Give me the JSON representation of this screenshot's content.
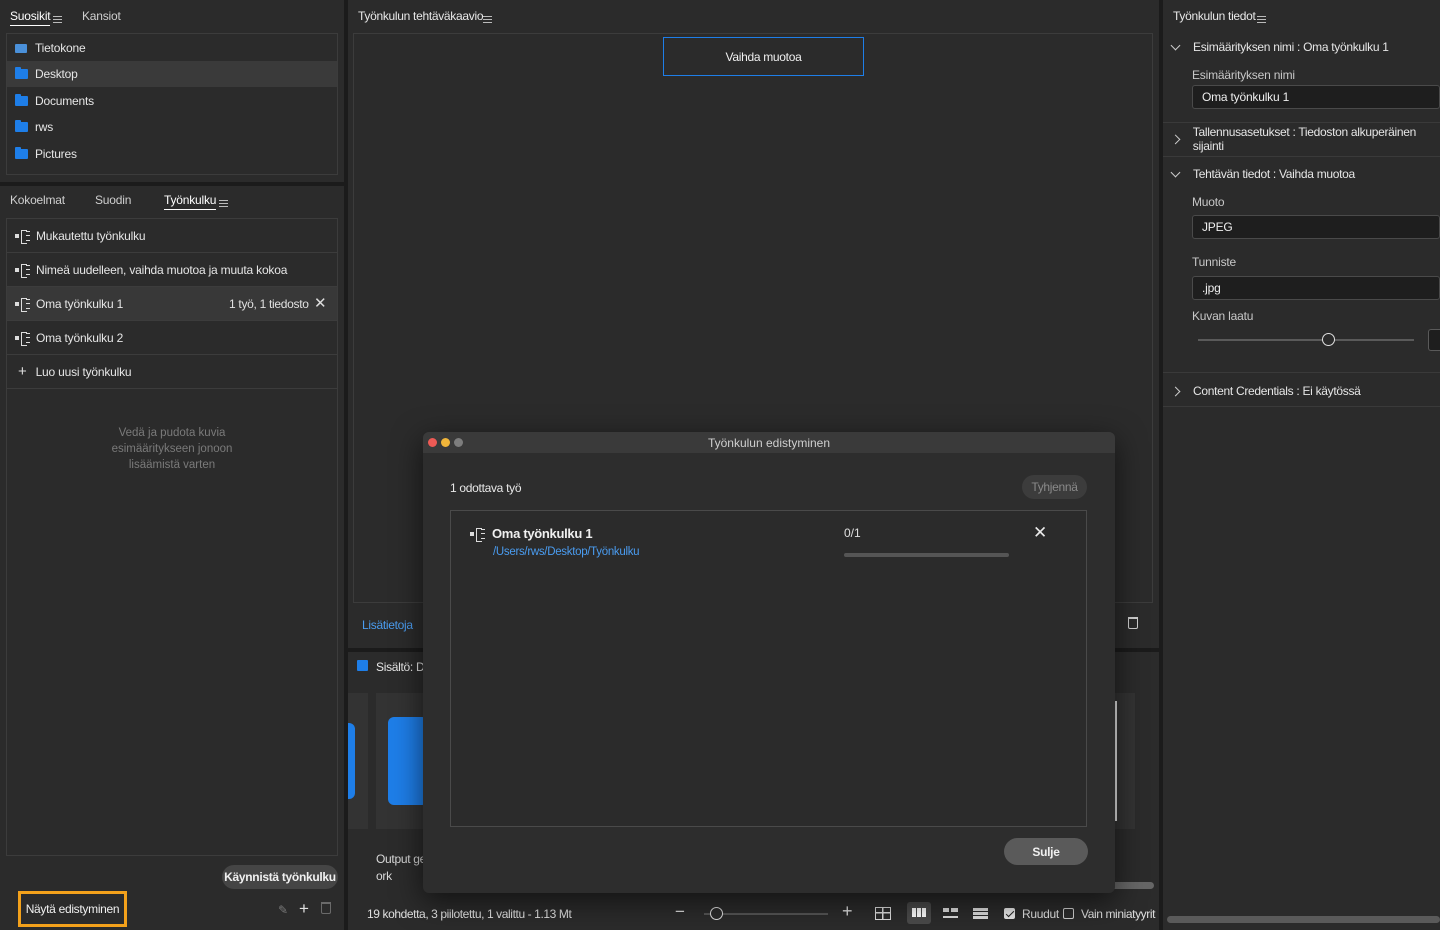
{
  "left": {
    "top_tabs": [
      {
        "label": "Suosikit",
        "active": true
      },
      {
        "label": "Kansiot",
        "active": false
      }
    ],
    "favorites": [
      {
        "label": "Tietokone",
        "icon": "computer-icon"
      },
      {
        "label": "Desktop",
        "icon": "folder-icon",
        "selected": true
      },
      {
        "label": "Documents",
        "icon": "folder-icon"
      },
      {
        "label": "rws",
        "icon": "folder-icon"
      },
      {
        "label": "Pictures",
        "icon": "folder-icon"
      }
    ],
    "mid_tabs": [
      {
        "label": "Kokoelmat",
        "active": false
      },
      {
        "label": "Suodin",
        "active": false
      },
      {
        "label": "Työnkulku",
        "active": true
      }
    ],
    "workflows": [
      {
        "label": "Mukautettu työnkulku"
      },
      {
        "label": "Nimeä uudelleen, vaihda muotoa ja muuta kokoa"
      },
      {
        "label": "Oma työnkulku 1",
        "meta": "1 työ, 1 tiedosto",
        "selected": true
      },
      {
        "label": "Oma työnkulku 2"
      }
    ],
    "create_new": "Luo uusi työnkulku",
    "drop_hint_lines": [
      "Vedä ja pudota kuvia",
      "esimääritykseen jonoon",
      "lisäämistä varten"
    ],
    "start_button": "Käynnistä työnkulku",
    "show_progress_button": "Näytä edistyminen"
  },
  "center": {
    "title": "Työnkulun tehtäväkaavio",
    "task_node": "Vaihda muotoa",
    "more_link": "Lisätietoja",
    "content_title": "Sisältö: De",
    "output_text_line1": "Output ger",
    "output_text_line2": "ork",
    "status": "19 kohdetta, 3 piilotettu, 1 valittu - 1.13 Mt",
    "zoom": {
      "minus": "−",
      "plus": "+",
      "level": 0.1
    },
    "grid_label": "Ruudut",
    "grid_checked": true,
    "thumbs_only_label": "Vain miniatyyrit",
    "thumbs_only_checked": false
  },
  "right": {
    "title": "Työnkulun tiedot",
    "preset_section": {
      "label": "Esimäärityksen nimi : Oma työnkulku 1",
      "expanded": true
    },
    "preset_name_label": "Esimäärityksen nimi",
    "preset_name_value": "Oma työnkulku 1",
    "save_section": {
      "label": "Tallennusasetukset : Tiedoston alkuperäinen sijainti",
      "expanded": false
    },
    "task_section": {
      "label": "Tehtävän tiedot : Vaihda muotoa",
      "expanded": true
    },
    "format_label": "Muoto",
    "format_value": "JPEG",
    "extension_label": "Tunniste",
    "extension_value": ".jpg",
    "quality_label": "Kuvan laatu",
    "quality_level": 0.6,
    "credentials_section": {
      "label": "Content Credentials : Ei käytössä",
      "expanded": false
    }
  },
  "dialog": {
    "title": "Työnkulun edistyminen",
    "pending": "1 odottava työ",
    "clear_button": "Tyhjennä",
    "job_name": "Oma työnkulku 1",
    "job_path": "/Users/rws/Desktop/Työnkulku",
    "job_count": "0/1",
    "job_progress": 0,
    "close_button": "Sulje"
  },
  "colors": {
    "accent": "#1e7ee8",
    "link": "#4a9cf0",
    "highlight": "#f3a11b"
  }
}
